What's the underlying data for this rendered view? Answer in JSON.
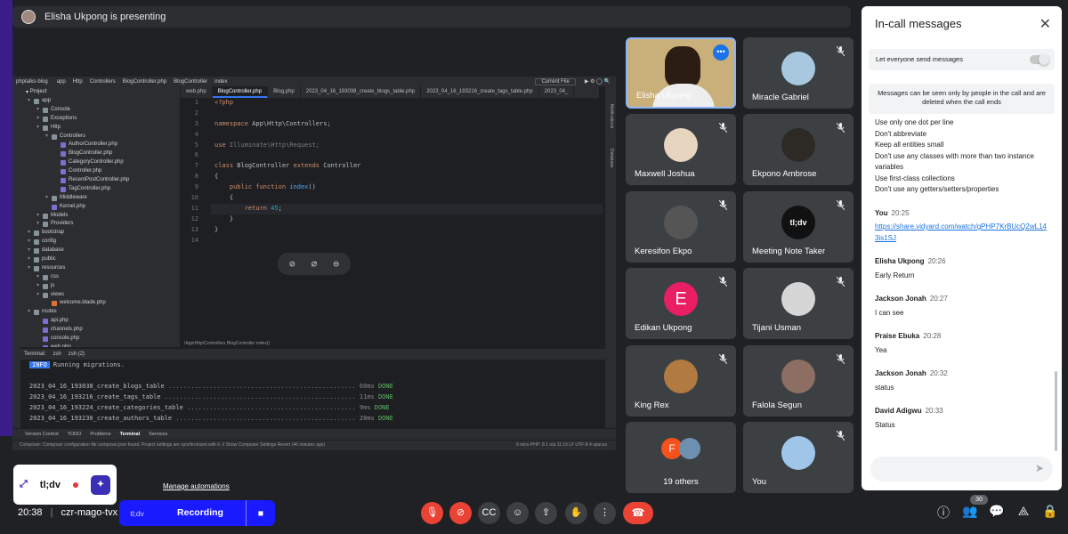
{
  "presenter_bar": {
    "text": "Elisha Ukpong is presenting"
  },
  "ide": {
    "project_name": "phptalks-blog",
    "breadcrumb": [
      "app",
      "Http",
      "Controllers",
      "BlogController.php",
      "BlogController",
      "index"
    ],
    "run_config": "Current File",
    "project_label": "Project",
    "tree": [
      {
        "d": 0,
        "t": "folder",
        "label": "app"
      },
      {
        "d": 1,
        "t": "folder",
        "label": "Console"
      },
      {
        "d": 1,
        "t": "folder",
        "label": "Exceptions"
      },
      {
        "d": 1,
        "t": "folder",
        "label": "Http"
      },
      {
        "d": 2,
        "t": "folder",
        "label": "Controllers"
      },
      {
        "d": 3,
        "t": "php",
        "label": "AuthorController.php"
      },
      {
        "d": 3,
        "t": "php",
        "label": "BlogController.php"
      },
      {
        "d": 3,
        "t": "php",
        "label": "CategoryController.php"
      },
      {
        "d": 3,
        "t": "php",
        "label": "Controller.php"
      },
      {
        "d": 3,
        "t": "php",
        "label": "RecentPostController.php"
      },
      {
        "d": 3,
        "t": "php",
        "label": "TagController.php"
      },
      {
        "d": 2,
        "t": "folder",
        "label": "Middleware"
      },
      {
        "d": 2,
        "t": "php",
        "label": "Kernel.php"
      },
      {
        "d": 1,
        "t": "folder",
        "label": "Models"
      },
      {
        "d": 1,
        "t": "folder",
        "label": "Providers"
      },
      {
        "d": 0,
        "t": "folder",
        "label": "bootstrap"
      },
      {
        "d": 0,
        "t": "folder",
        "label": "config"
      },
      {
        "d": 0,
        "t": "folder",
        "label": "database"
      },
      {
        "d": 0,
        "t": "folder",
        "label": "public"
      },
      {
        "d": 0,
        "t": "folder",
        "label": "resources"
      },
      {
        "d": 1,
        "t": "folder",
        "label": "css"
      },
      {
        "d": 1,
        "t": "folder",
        "label": "js"
      },
      {
        "d": 1,
        "t": "folder",
        "label": "views"
      },
      {
        "d": 2,
        "t": "blade",
        "label": "welcome.blade.php"
      },
      {
        "d": 0,
        "t": "folder",
        "label": "routes"
      },
      {
        "d": 1,
        "t": "php",
        "label": "api.php"
      },
      {
        "d": 1,
        "t": "php",
        "label": "channels.php"
      },
      {
        "d": 1,
        "t": "php",
        "label": "console.php"
      },
      {
        "d": 1,
        "t": "php",
        "label": "web.php"
      }
    ],
    "tabs": [
      {
        "label": "web.php",
        "active": false
      },
      {
        "label": "BlogController.php",
        "active": true
      },
      {
        "label": "Blog.php",
        "active": false
      },
      {
        "label": "2023_04_16_193038_create_blogs_table.php",
        "active": false
      },
      {
        "label": "2023_04_16_193216_create_tags_table.php",
        "active": false
      },
      {
        "label": "2023_04_",
        "active": false
      }
    ],
    "line_numbers": [
      "1",
      "2",
      "3",
      "4",
      "5",
      "6",
      "7",
      "8",
      "9",
      "10",
      "11",
      "12",
      "13",
      "14"
    ],
    "pathbar": "\\App\\Http\\Controllers  BlogController  index()",
    "terminal_label": "Terminal:",
    "terminal_tabs": [
      "zsh",
      "zsh (2)"
    ],
    "terminal_info_badge": "INFO",
    "terminal_info_text": "Running migrations.",
    "migrations": [
      {
        "name": "2023_04_16_193038_create_blogs_table",
        "ms": "60ms",
        "status": "DONE"
      },
      {
        "name": "2023_04_16_193216_create_tags_table",
        "ms": "11ms",
        "status": "DONE"
      },
      {
        "name": "2023_04_16_193224_create_categories_table",
        "ms": "9ms",
        "status": "DONE"
      },
      {
        "name": "2023_04_16_193230_create_authors_table",
        "ms": "28ms",
        "status": "DONE"
      }
    ],
    "bottom_tabs": [
      "Version Control",
      "TODO",
      "Problems",
      "Terminal",
      "Services"
    ],
    "status_left": "Composer: Composer configuration file composer.json found. Project settings are synchronized with it. // Show Composer Settings   Revert (46 minutes ago)",
    "status_right": "9 mins   PHP: 8.1   n/a   11:19   LF   UTF-8   4 spaces",
    "side_labels": [
      "Notifications",
      "Database"
    ],
    "float_icons": [
      "mic-off-icon",
      "screen-off-icon",
      "minus-circle-icon"
    ]
  },
  "participants": [
    {
      "name": "Elisha Ukpong",
      "kind": "video",
      "active": true,
      "color": "#c9b07a"
    },
    {
      "name": "Miracle Gabriel",
      "kind": "photo",
      "color": "#a8c8e0"
    },
    {
      "name": "Maxwell Joshua",
      "kind": "photo",
      "color": "#e8d5c0"
    },
    {
      "name": "Ekpono Ambrose",
      "kind": "photo",
      "color": "#2d2a26"
    },
    {
      "name": "Keresifon Ekpo",
      "kind": "photo",
      "color": "#555"
    },
    {
      "name": "Meeting Note Taker",
      "kind": "tldv",
      "color": "#111",
      "logo": "tl;dv"
    },
    {
      "name": "Edikan Ukpong",
      "kind": "initial",
      "initial": "E",
      "color": "#e91e63"
    },
    {
      "name": "Tijani Usman",
      "kind": "photo",
      "color": "#d6d6d6"
    },
    {
      "name": "King Rex",
      "kind": "photo",
      "color": "#b07a40"
    },
    {
      "name": "Falola Segun",
      "kind": "photo",
      "color": "#8d6e63"
    },
    {
      "name": "19 others",
      "kind": "others",
      "initial": "F",
      "color": "#f4511e"
    },
    {
      "name": "You",
      "kind": "photo",
      "color": "#9fc6e8"
    }
  ],
  "chat": {
    "title": "In-call messages",
    "toggle_label": "Let everyone send messages",
    "notice": "Messages can be seen only by people in the call and are deleted when the call ends",
    "rules": [
      "Use only one dot per line",
      "Don't abbreviate",
      "Keep all entities small",
      "Don't use any classes with more than two instance variables",
      "Use first-class collections",
      "Don't use any getters/setters/properties"
    ],
    "messages": [
      {
        "sender": "You",
        "time": "20:25",
        "text": "https://share.vidyard.com/watch/gPHP7KrBUcQ2wL143is1SJ",
        "link": true
      },
      {
        "sender": "Elisha Ukpong",
        "time": "20:26",
        "text": "Early Return"
      },
      {
        "sender": "Jackson Jonah",
        "time": "20:27",
        "text": "I can see"
      },
      {
        "sender": "Praise Ebuka",
        "time": "20:28",
        "text": "Yea"
      },
      {
        "sender": "Jackson Jonah",
        "time": "20:32",
        "text": "status"
      },
      {
        "sender": "David Adigwu",
        "time": "20:33",
        "text": "Status"
      }
    ]
  },
  "bottom": {
    "tldv_logo": "tl;dv",
    "manage": "Manage automations",
    "clock": "20:38",
    "separator": "|",
    "meeting_code": "czr-mago-tvx",
    "rec_logo": "tl;dv",
    "recording": "Recording",
    "participants_count": "30"
  }
}
